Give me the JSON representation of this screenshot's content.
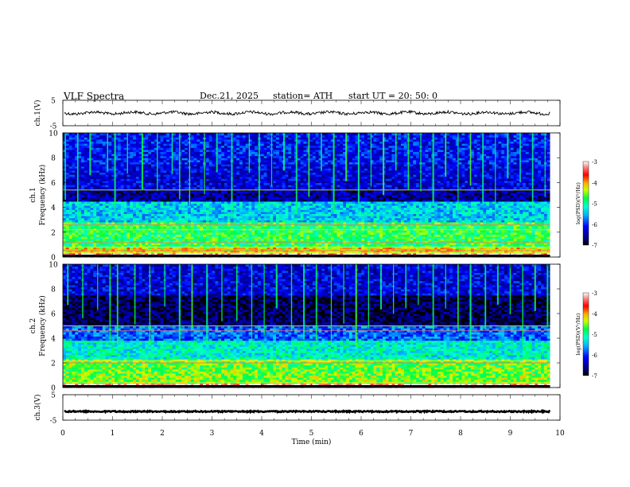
{
  "header": {
    "title": "VLF  Spectra",
    "date": "Dec.21, 2025",
    "station": "station= ATH",
    "start": "start  UT  =    20: 50: 0"
  },
  "chart_data": {
    "type": "heatmap",
    "x_axis": {
      "label": "Time  (min)",
      "range": [
        0,
        10
      ],
      "ticks": [
        "0",
        "1",
        "2",
        "3",
        "4",
        "5",
        "6",
        "7",
        "8",
        "9",
        "10"
      ]
    },
    "panels": [
      {
        "id": "ch1-waveform",
        "type": "line",
        "ylabel": "ch.1(V)",
        "yrange": [
          -5,
          5
        ],
        "yticks": [
          "5",
          "-5"
        ],
        "trace_level": 0
      },
      {
        "id": "ch1-spectrogram",
        "type": "heatmap",
        "ylabel": "ch.1\nFrequency  (kHz)",
        "ylabel_lines": [
          "ch.1",
          "Frequency  (kHz)"
        ],
        "yrange": [
          0,
          10
        ],
        "yticks": [
          "0",
          "2",
          "4",
          "6",
          "8",
          "10"
        ],
        "colorbar": {
          "label": "log(PSD)(V²/Hz)",
          "range": [
            -7,
            -3
          ],
          "ticks": [
            "-3",
            "-4",
            "-5",
            "-6",
            "-7"
          ]
        },
        "bands": [
          {
            "from": 0.0,
            "to": 0.3,
            "level": 0.98
          },
          {
            "from": 0.3,
            "to": 0.9,
            "level": 0.7
          },
          {
            "from": 0.9,
            "to": 2.8,
            "level": 0.55
          },
          {
            "from": 2.8,
            "to": 4.5,
            "level": 0.4
          },
          {
            "from": 4.5,
            "to": 5.5,
            "level": 0.12
          },
          {
            "from": 5.5,
            "to": 7.5,
            "level": 0.18
          },
          {
            "from": 7.5,
            "to": 10.0,
            "level": 0.22
          }
        ],
        "hot_lines_khz": [
          0.35,
          0.55,
          0.8,
          1.2,
          2.2,
          2.6,
          5.4
        ],
        "spike_times_min": [
          0.05,
          0.3,
          0.55,
          0.9,
          1.05,
          1.3,
          1.6,
          1.9,
          2.2,
          2.35,
          2.55,
          2.85,
          3.1,
          3.4,
          3.75,
          3.95,
          4.2,
          4.45,
          4.7,
          4.95,
          5.2,
          5.45,
          5.7,
          5.95,
          6.2,
          6.45,
          6.7,
          6.95,
          7.2,
          7.45,
          7.7,
          7.95,
          8.2,
          8.45,
          8.7,
          8.95,
          9.2,
          9.45,
          9.7
        ]
      },
      {
        "id": "ch2-spectrogram",
        "type": "heatmap",
        "ylabel": "ch.2\nFrequency  (kHz)",
        "ylabel_lines": [
          "ch.2",
          "Frequency  (kHz)"
        ],
        "yrange": [
          0,
          10
        ],
        "yticks": [
          "0",
          "2",
          "4",
          "6",
          "8",
          "10"
        ],
        "colorbar": {
          "label": "log(PSD)(V²/Hz)",
          "range": [
            -7,
            -3
          ],
          "ticks": [
            "-3",
            "-4",
            "-5",
            "-6",
            "-7"
          ]
        },
        "bands": [
          {
            "from": 0.0,
            "to": 0.3,
            "level": 0.98
          },
          {
            "from": 0.3,
            "to": 1.2,
            "level": 0.62
          },
          {
            "from": 1.2,
            "to": 2.4,
            "level": 0.6
          },
          {
            "from": 2.4,
            "to": 3.8,
            "level": 0.45
          },
          {
            "from": 3.8,
            "to": 5.0,
            "level": 0.3
          },
          {
            "from": 5.0,
            "to": 7.5,
            "level": 0.06
          },
          {
            "from": 7.5,
            "to": 10.0,
            "level": 0.18
          }
        ],
        "hot_lines_khz": [
          0.4,
          2.0,
          2.15,
          4.6,
          5.0
        ],
        "spike_times_min": [
          0.1,
          0.4,
          0.7,
          0.95,
          1.1,
          1.45,
          1.75,
          2.05,
          2.35,
          2.6,
          2.9,
          3.2,
          3.5,
          3.8,
          4.05,
          4.3,
          4.6,
          4.85,
          5.1,
          5.4,
          5.65,
          5.9,
          6.15,
          6.4,
          6.65,
          6.9,
          7.15,
          7.45,
          7.7,
          7.95,
          8.2,
          8.5,
          8.75,
          9.0,
          9.25,
          9.5,
          9.75
        ]
      },
      {
        "id": "ch3-waveform",
        "type": "line",
        "ylabel": "ch.3(V)",
        "yrange": [
          -5,
          5
        ],
        "yticks": [
          "5",
          "-5"
        ],
        "trace_level": -1.6
      }
    ]
  }
}
